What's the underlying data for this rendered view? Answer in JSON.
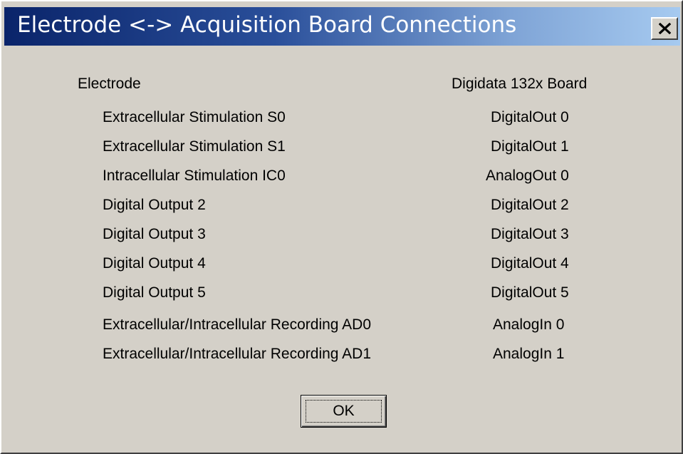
{
  "window": {
    "title": "Electrode <-> Acquisition Board Connections",
    "close_label": "×"
  },
  "headers": {
    "electrode": "Electrode",
    "board": "Digidata 132x Board"
  },
  "connections": [
    {
      "electrode": "Extracellular Stimulation  S0",
      "board": "DigitalOut 0"
    },
    {
      "electrode": "Extracellular Stimulation  S1",
      "board": "DigitalOut 1"
    },
    {
      "electrode": "Intracellular Stimulation  IC0",
      "board": "AnalogOut 0"
    },
    {
      "electrode": "Digital Output 2",
      "board": "DigitalOut 2"
    },
    {
      "electrode": "Digital Output 3",
      "board": "DigitalOut 3"
    },
    {
      "electrode": "Digital Output 4",
      "board": "DigitalOut 4"
    },
    {
      "electrode": "Digital Output 5",
      "board": "DigitalOut 5"
    },
    {
      "electrode": "Extracellular/Intracellular Recording  AD0",
      "board": "AnalogIn 0"
    },
    {
      "electrode": "Extracellular/Intracellular Recording  AD1",
      "board": "AnalogIn 1"
    }
  ],
  "ok_label": "OK",
  "colors": {
    "face": "#d4d0c8",
    "title_start": "#0a246a",
    "title_end": "#a6caf0"
  }
}
